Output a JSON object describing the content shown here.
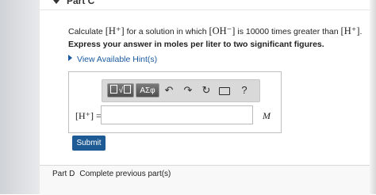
{
  "part_c": {
    "label": "Part C"
  },
  "question": {
    "prefix": "Calculate ",
    "target": "[H⁺]",
    "middle": " for a solution in which ",
    "given": "[OH⁻]",
    "suffix": " is 10000 times greater than ",
    "compare": "[H⁺]",
    "end": "."
  },
  "instruction": "Express your answer in moles per liter to two significant figures.",
  "hints": {
    "label": "View Available Hint(s)"
  },
  "toolbar": {
    "template_label": "√",
    "symbols_label": "ΑΣφ",
    "undo_icon": "undo-icon",
    "redo_icon": "redo-icon",
    "reset_icon": "reset-icon",
    "keyboard_icon": "keyboard-icon",
    "help_label": "?"
  },
  "answer": {
    "label": "[H⁺] =",
    "value": "",
    "unit": "M"
  },
  "submit": {
    "label": "Submit"
  },
  "part_d": {
    "label": "Part D",
    "status": "Complete previous part(s)"
  }
}
